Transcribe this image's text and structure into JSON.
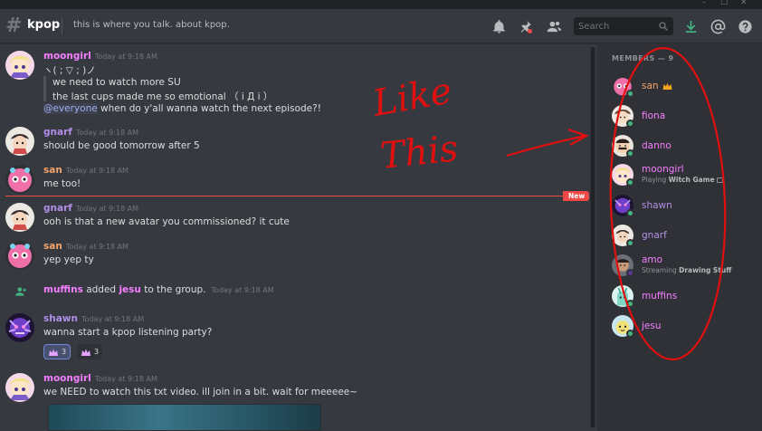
{
  "window": {
    "minimize": "–",
    "maximize": "☐",
    "close": "✕"
  },
  "header": {
    "channel_name": "kpop",
    "topic": "this is where you talk. about kpop.",
    "search_placeholder": "Search",
    "icons": [
      "bell-icon",
      "pin-icon",
      "members-icon",
      "search-icon",
      "download-icon",
      "mention-icon",
      "help-icon"
    ]
  },
  "messages": [
    {
      "author": "moongirl",
      "time": "Today at 9:18 AM",
      "lines": [
        "ヽ( ; ▽ ; )ノ"
      ],
      "quote": [
        "we need to watch more SU",
        "the last cups made me so emotional （ i Д i ）"
      ],
      "mention": "@everyone",
      "after_mention": " when do y'all wanna watch the next episode?!"
    },
    {
      "author": "gnarf",
      "time": "Today at 9:18 AM",
      "lines": [
        "should be good tomorrow after 5"
      ]
    },
    {
      "author": "san",
      "time": "Today at 9:18 AM",
      "lines": [
        "me too!"
      ]
    },
    {
      "author": "gnarf",
      "time": "Today at 9:18 AM",
      "lines": [
        "ooh is that a new avatar you commissioned? it cute"
      ]
    },
    {
      "author": "san",
      "time": "Today at 9:18 AM",
      "lines": [
        "yep yep ty"
      ]
    },
    {
      "system": {
        "actor": "muffins",
        "verb": " added ",
        "target": "jesu",
        "rest": " to the group.",
        "time": "Today at 9:18 AM"
      }
    },
    {
      "author": "shawn",
      "time": "Today at 9:18 AM",
      "lines": [
        "wanna start a kpop listening party?"
      ]
    },
    {
      "author": "moongirl",
      "time": "Today at 9:18 AM",
      "lines": [
        "we NEED to watch this txt video. ill join in a bit. wait for meeeee~"
      ]
    }
  ],
  "new_badge": "New",
  "reactions": [
    {
      "emoji": "crown-icon",
      "count": "3"
    },
    {
      "emoji": "crown-icon",
      "count": "3"
    }
  ],
  "members_header": "MEMBERS — 9",
  "members": [
    {
      "name": "san",
      "badge": "crown-icon"
    },
    {
      "name": "fiona"
    },
    {
      "name": "danno"
    },
    {
      "name": "moongirl",
      "activity_prefix": "Playing ",
      "activity_name": "Witch Game"
    },
    {
      "name": "shawn"
    },
    {
      "name": "gnarf"
    },
    {
      "name": "amo",
      "activity_prefix": "Streaming ",
      "activity_name": "Drawing Stuff"
    },
    {
      "name": "muffins"
    },
    {
      "name": "jesu"
    }
  ],
  "annotation": {
    "line1": "Like",
    "line2": "This"
  },
  "colors": {
    "moongirl": "#f47fff",
    "gnarf": "#b28ee8",
    "san": "#f4a36b",
    "shawn": "#b28ee8",
    "fiona": "#f47fff",
    "danno": "#f47fff",
    "amo": "#f47fff",
    "muffins": "#f47fff",
    "jesu": "#f47fff",
    "new": "#f04747",
    "online": "#43b581",
    "annotation": "#e01010"
  }
}
